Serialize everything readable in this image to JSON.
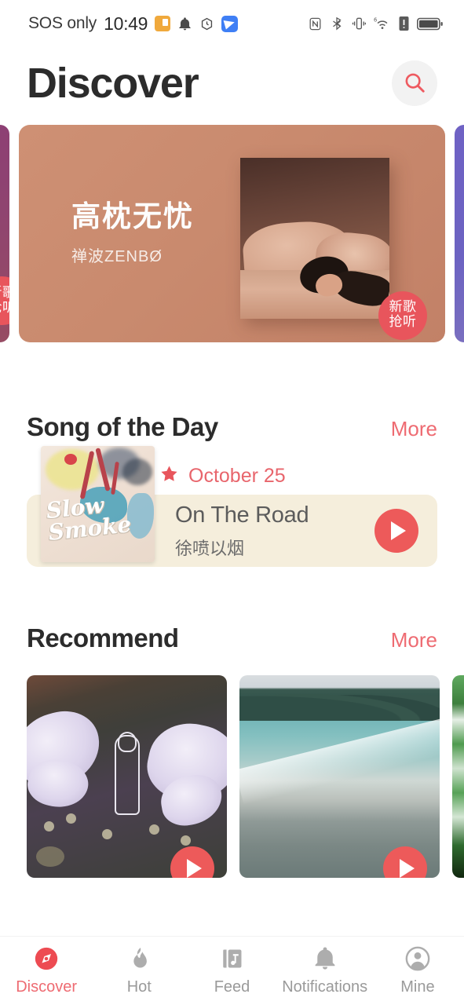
{
  "status_bar": {
    "carrier": "SOS only",
    "time": "10:49",
    "left_icons": [
      "calendar-icon",
      "bell-icon",
      "alarm-icon",
      "app-icon"
    ],
    "right_icons": [
      "nfc-icon",
      "bluetooth-icon",
      "vibrate-icon",
      "wifi-icon",
      "sim-alert-icon",
      "battery-icon"
    ],
    "wifi_generation": "6"
  },
  "header": {
    "title": "Discover",
    "search_icon": "search-icon"
  },
  "carousel": {
    "active_index": 1,
    "slides": [
      {
        "title": "",
        "artist": "",
        "badge": "新歌抢听",
        "theme": "#8d3f74"
      },
      {
        "title": "高枕无忧",
        "artist": "禅波ZENBØ",
        "badge_line1": "新歌",
        "badge_line2": "抢听",
        "theme": "#C98A6E"
      },
      {
        "title": "",
        "artist": "",
        "badge": "",
        "theme": "#6c63c2"
      }
    ]
  },
  "song_of_the_day": {
    "section_title": "Song of the Day",
    "more_label": "More",
    "date": "October 25",
    "star_icon": "star-icon",
    "album_art_text": "Slow Smoke",
    "song": "On The Road",
    "artist": "徐喷以烟",
    "play_icon": "play-icon"
  },
  "recommend": {
    "section_title": "Recommend",
    "more_label": "More",
    "cards": [
      {
        "art": "flowers-figure-painting",
        "play_icon": "play-icon"
      },
      {
        "art": "beach-ocean-photo",
        "play_icon": "play-icon"
      },
      {
        "art": "green-abstract",
        "play_icon": "play-icon"
      }
    ]
  },
  "bottom_nav": {
    "active": "Discover",
    "items": [
      {
        "label": "Discover",
        "icon": "compass-icon"
      },
      {
        "label": "Hot",
        "icon": "flame-icon"
      },
      {
        "label": "Feed",
        "icon": "music-book-icon"
      },
      {
        "label": "Notifications",
        "icon": "bell-icon"
      },
      {
        "label": "Mine",
        "icon": "person-icon"
      }
    ]
  },
  "colors": {
    "accent_red": "#EE6B72",
    "play_red": "#ED5A5A",
    "badge_red": "#E8555C",
    "banner_bg": "#C98A6E",
    "card_cream": "#F5EEDC",
    "title_dark": "#2c2c2c",
    "muted_gray": "#9a9a9a"
  }
}
